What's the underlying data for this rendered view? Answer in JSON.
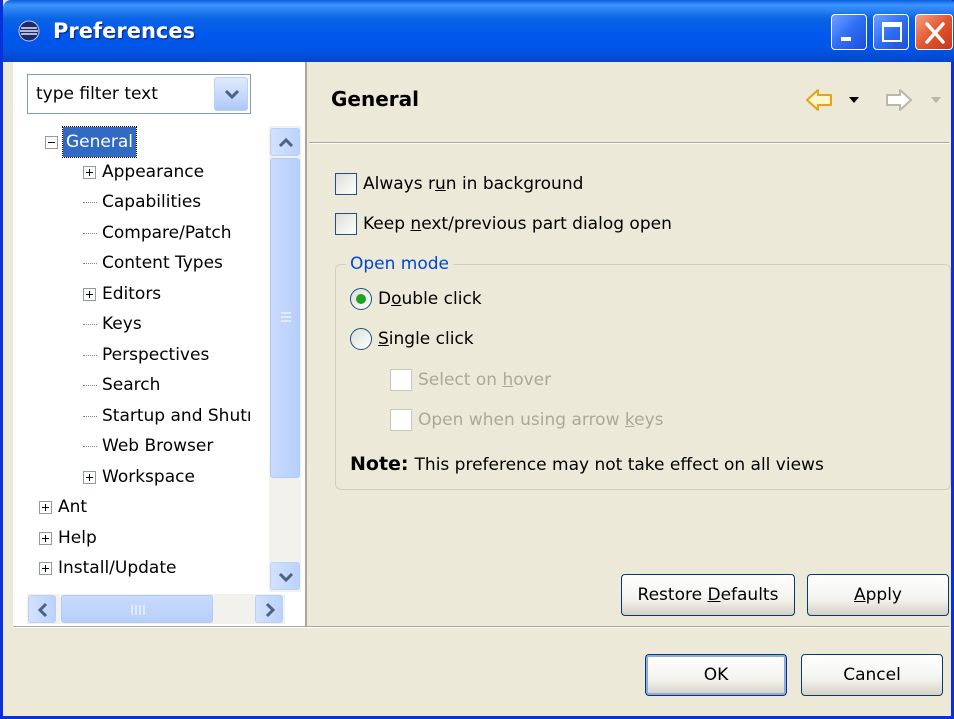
{
  "window": {
    "title": "Preferences"
  },
  "filter": {
    "placeholder": "type filter text"
  },
  "tree": {
    "items": [
      {
        "label": "General",
        "expander": "minus",
        "selected": true
      },
      {
        "label": "Appearance",
        "expander": "plus"
      },
      {
        "label": "Capabilities"
      },
      {
        "label": "Compare/Patch"
      },
      {
        "label": "Content Types"
      },
      {
        "label": "Editors",
        "expander": "plus"
      },
      {
        "label": "Keys"
      },
      {
        "label": "Perspectives"
      },
      {
        "label": "Search"
      },
      {
        "label": "Startup and Shutı"
      },
      {
        "label": "Web Browser"
      },
      {
        "label": "Workspace",
        "expander": "plus"
      },
      {
        "label": "Ant",
        "expander": "plus"
      },
      {
        "label": "Help",
        "expander": "plus"
      },
      {
        "label": "Install/Update",
        "expander": "plus"
      }
    ]
  },
  "page": {
    "title": "General",
    "options": {
      "always_run_background": {
        "pre": "Always r",
        "mn": "u",
        "post": "n in background",
        "checked": false
      },
      "keep_part_dialog_open": {
        "pre": "Keep ",
        "mn": "n",
        "post": "ext/previous part dialog open",
        "checked": false
      }
    },
    "open_mode": {
      "title": "Open mode",
      "double_click": {
        "pre": "D",
        "mn": "o",
        "post": "uble click",
        "selected": true
      },
      "single_click": {
        "pre": "",
        "mn": "S",
        "post": "ingle click",
        "selected": false
      },
      "select_on_hover": {
        "pre": "Select on ",
        "mn": "h",
        "post": "over",
        "enabled": false
      },
      "open_arrow_keys": {
        "pre": "Open when using arrow ",
        "mn": "k",
        "post": "eys",
        "enabled": false
      },
      "note_label": "Note:",
      "note_text": "This preference may not take effect on all views"
    }
  },
  "buttons": {
    "restore": {
      "pre": "Restore ",
      "mn": "D",
      "post": "efaults"
    },
    "apply": {
      "pre": "",
      "mn": "A",
      "post": "pply"
    },
    "ok": "OK",
    "cancel": "Cancel"
  },
  "colors": {
    "titlebar": "#0058ee",
    "selection": "#316ac5",
    "group_title": "#0046d5",
    "back_arrow": "#e8a215"
  }
}
